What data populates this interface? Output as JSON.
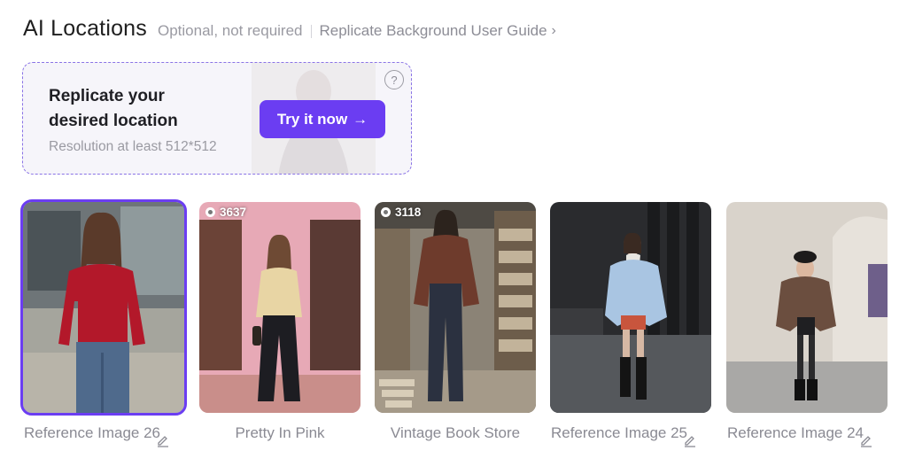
{
  "header": {
    "title": "AI Locations",
    "subtitle": "Optional, not required",
    "guide_link": "Replicate Background User Guide",
    "guide_chevron": "›"
  },
  "upload": {
    "title": "Replicate your desired location",
    "resolution_hint": "Resolution at least 512*512",
    "button_label": "Try it now",
    "button_arrow": "→",
    "help_symbol": "?",
    "accent_color": "#6b3df2"
  },
  "cards": [
    {
      "caption": "Reference Image 26",
      "selected": true,
      "editable": true,
      "badge": "",
      "scene": "street"
    },
    {
      "caption": "Pretty In Pink",
      "selected": false,
      "editable": false,
      "badge": "3637",
      "scene": "pink-wall"
    },
    {
      "caption": "Vintage Book Store",
      "selected": false,
      "editable": false,
      "badge": "3118",
      "scene": "bookstore"
    },
    {
      "caption": "Reference Image 25",
      "selected": false,
      "editable": true,
      "badge": "",
      "scene": "dark-building"
    },
    {
      "caption": "Reference Image 24",
      "selected": false,
      "editable": true,
      "badge": "",
      "scene": "studio"
    }
  ],
  "icons": {
    "badge_icon": "image-count-icon",
    "edit_icon": "pencil-icon",
    "help_icon": "question-icon"
  }
}
